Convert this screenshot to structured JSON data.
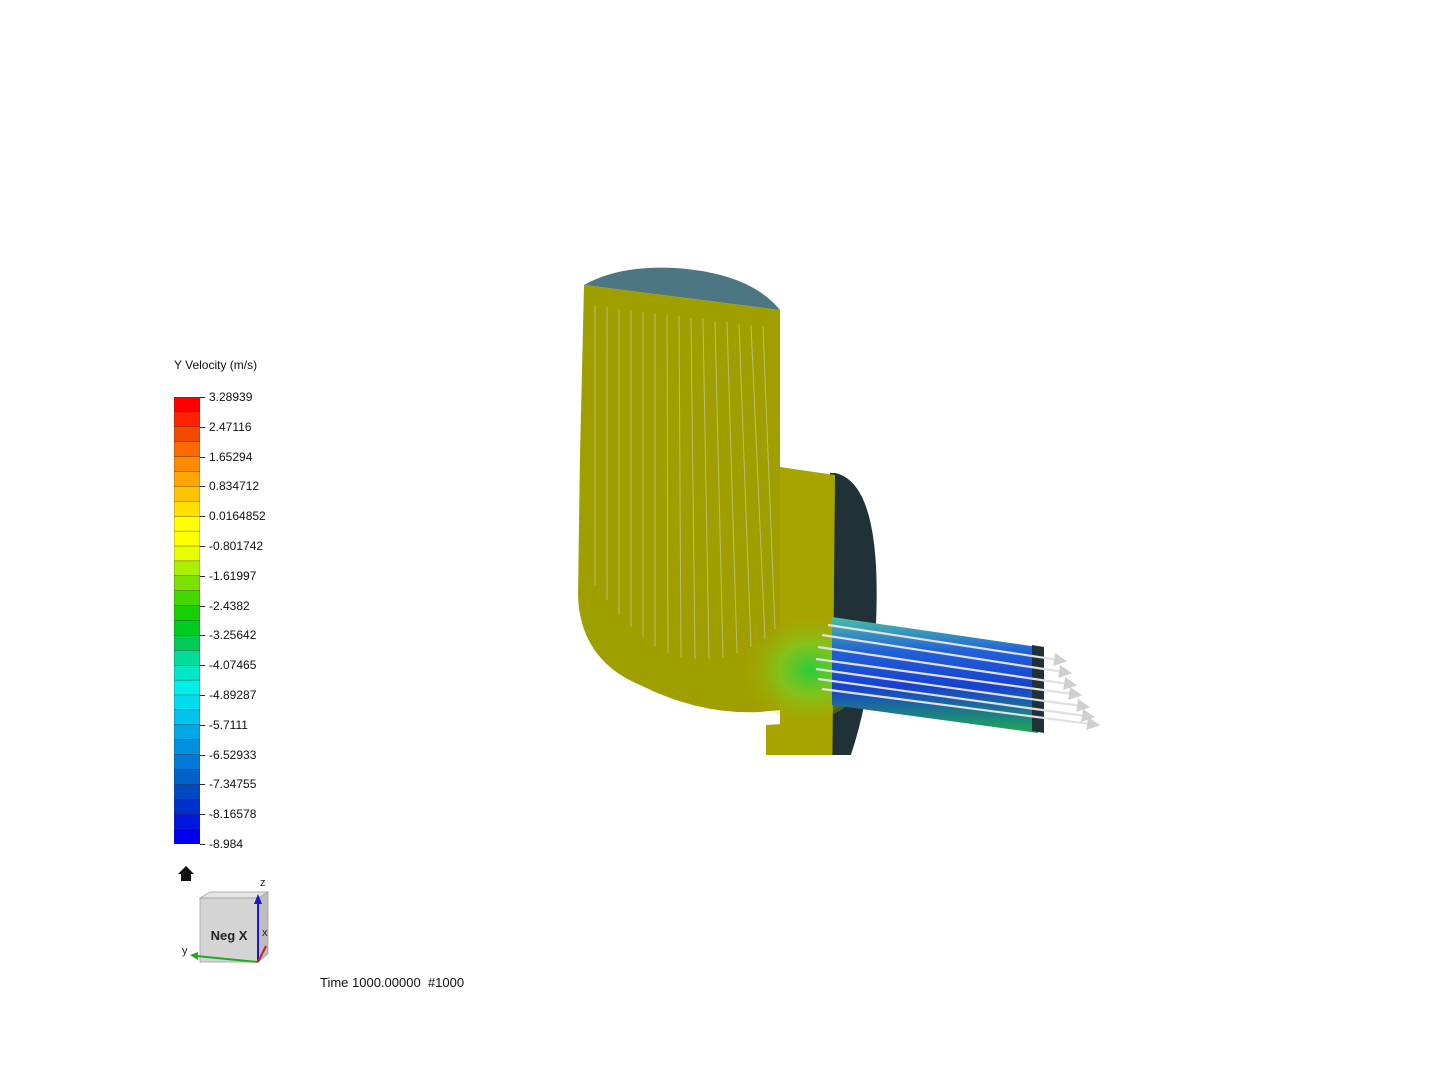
{
  "legend": {
    "title": "Y Velocity (m/s)",
    "ticks": [
      "3.28939",
      "2.47116",
      "1.65294",
      "0.834712",
      "0.0164852",
      "-0.801742",
      "-1.61997",
      "-2.4382",
      "-3.25642",
      "-4.07465",
      "-4.89287",
      "-5.7111",
      "-6.52933",
      "-7.34755",
      "-8.16578",
      "-8.984"
    ],
    "colors": [
      "#ff0000",
      "#ff2200",
      "#f44a00",
      "#ff6a00",
      "#ff8a00",
      "#ffa600",
      "#ffc400",
      "#ffe000",
      "#ffff00",
      "#ffff00",
      "#e6ff00",
      "#aaf000",
      "#7ce000",
      "#44d800",
      "#18d000",
      "#00cc20",
      "#00cc55",
      "#00dd99",
      "#00e8c8",
      "#00eee8",
      "#00dcee",
      "#00c4ee",
      "#00a8e8",
      "#0090e0",
      "#0078d8",
      "#0060cc",
      "#0048c4",
      "#0030cc",
      "#0018dd",
      "#0000ee"
    ]
  },
  "orientation": {
    "face_label": "Neg X",
    "axis_x": "x",
    "axis_y": "y",
    "axis_z": "z"
  },
  "time": {
    "label": "Time 1000.00000  #1000"
  },
  "icons": {
    "home": "home-icon"
  }
}
